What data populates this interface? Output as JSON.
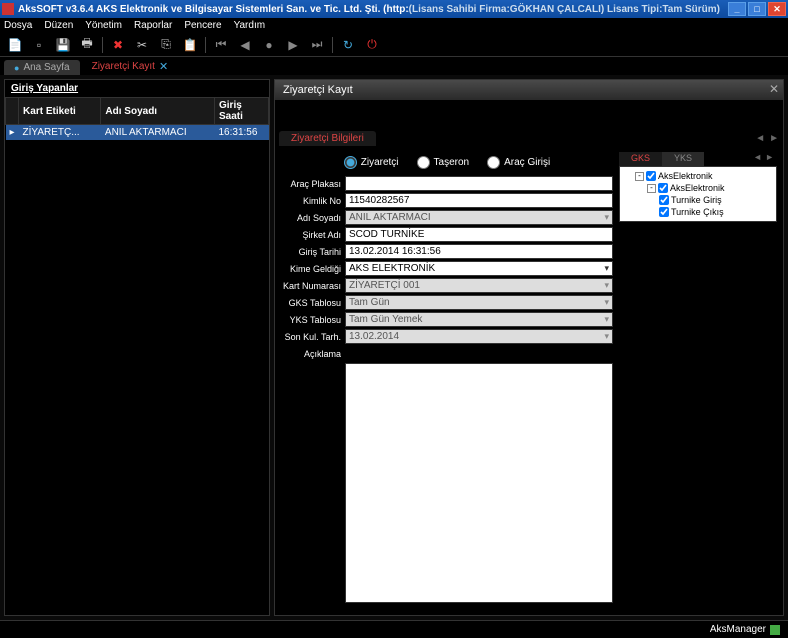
{
  "title": {
    "app": "AksSOFT v3.6.4 AKS Elektronik ve Bilgisayar Sistemleri San. ve Tic. Ltd. Şti. (http://www.akselektronik.com)",
    "license": "(Lisans Sahibi Firma:GÖKHAN ÇALCALI)  Lisans Tipi:Tam Sürüm)"
  },
  "menu": {
    "dosya": "Dosya",
    "duzen": "Düzen",
    "yonetim": "Yönetim",
    "raporlar": "Raporlar",
    "pencere": "Pencere",
    "yardim": "Yardım"
  },
  "tabs": {
    "home": "Ana Sayfa",
    "active": "Ziyaretçi Kayıt"
  },
  "left": {
    "title": "Giriş Yapanlar",
    "cols": {
      "kart": "Kart Etiketi",
      "adi": "Adı Soyadı",
      "giris": "Giriş Saati"
    },
    "rows": [
      {
        "kart": "ZİYARETÇ...",
        "adi": "ANIL AKTARMACI",
        "giris": "16:31:56"
      }
    ]
  },
  "panel": {
    "title": "Ziyaretçi Kayıt"
  },
  "section": {
    "tab": "Ziyaretçi Bilgileri"
  },
  "radios": {
    "ziyaretci": "Ziyaretçi",
    "taseron": "Taşeron",
    "arac": "Araç Girişi"
  },
  "form": {
    "labels": {
      "plaka": "Araç Plakası",
      "kimlik": "Kimlik No",
      "adsoyad": "Adı Soyadı",
      "sirket": "Şirket Adı",
      "giris": "Giriş Tarihi",
      "kime": "Kime Geldiği",
      "kart": "Kart Numarası",
      "gks": "GKS Tablosu",
      "yks": "YKS Tablosu",
      "sonkul": "Son Kul. Tarh.",
      "aciklama": "Açıklama"
    },
    "values": {
      "plaka": "",
      "kimlik": "11540282567",
      "adsoyad": "ANIL AKTARMACI",
      "sirket": "SCOD TURNİKE",
      "giris": "13.02.2014 16:31:56",
      "kime": "AKS ELEKTRONİK",
      "kart": "ZİYARETÇİ 001",
      "gks": "Tam Gün",
      "yks": "Tam Gün Yemek",
      "sonkul": "13.02.2014",
      "aciklama": ""
    }
  },
  "tree": {
    "tabs": {
      "gks": "GKS",
      "yks": "YKS"
    },
    "nodes": {
      "root": "AksElektronik",
      "child": "AksElektronik",
      "leaf1": "Turnike Giriş",
      "leaf2": "Turnike Çıkış"
    }
  },
  "status": {
    "label": "AksManager"
  }
}
